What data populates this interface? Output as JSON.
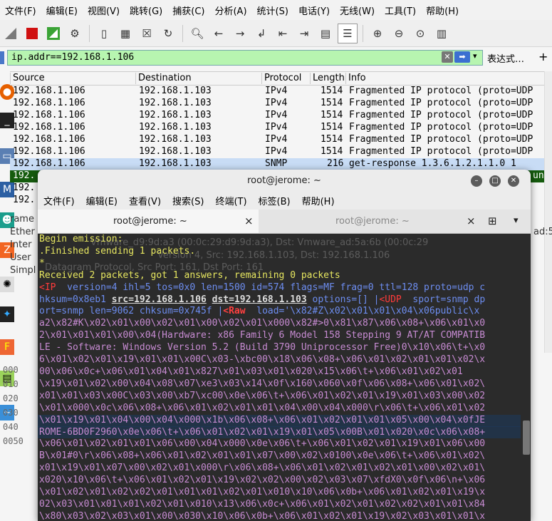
{
  "menu": [
    "文件(F)",
    "编辑(E)",
    "视图(V)",
    "跳转(G)",
    "捕获(C)",
    "分析(A)",
    "统计(S)",
    "电话(Y)",
    "无线(W)",
    "工具(T)",
    "帮助(H)"
  ],
  "filter": {
    "value": "ip.addr==192.168.1.106",
    "expression_label": "表达式…",
    "plus": "+"
  },
  "columns": {
    "source": "Source",
    "destination": "Destination",
    "protocol": "Protocol",
    "length": "Length",
    "info": "Info"
  },
  "packets": [
    {
      "src": "192.168.1.106",
      "dst": "192.168.1.103",
      "proto": "IPv4",
      "len": "1514",
      "info": "Fragmented IP protocol (proto=UDP"
    },
    {
      "src": "192.168.1.106",
      "dst": "192.168.1.103",
      "proto": "IPv4",
      "len": "1514",
      "info": "Fragmented IP protocol (proto=UDP"
    },
    {
      "src": "192.168.1.106",
      "dst": "192.168.1.103",
      "proto": "IPv4",
      "len": "1514",
      "info": "Fragmented IP protocol (proto=UDP"
    },
    {
      "src": "192.168.1.106",
      "dst": "192.168.1.103",
      "proto": "IPv4",
      "len": "1514",
      "info": "Fragmented IP protocol (proto=UDP"
    },
    {
      "src": "192.168.1.106",
      "dst": "192.168.1.103",
      "proto": "IPv4",
      "len": "1514",
      "info": "Fragmented IP protocol (proto=UDP"
    },
    {
      "src": "192.168.1.106",
      "dst": "192.168.1.103",
      "proto": "IPv4",
      "len": "1514",
      "info": "Fragmented IP protocol (proto=UDP"
    },
    {
      "src": "192.168.1.106",
      "dst": "192.168.1.103",
      "proto": "SNMP",
      "len": "216",
      "info": "get-response 1.3.6.1.2.1.1.0 1"
    }
  ],
  "partial_rows": [
    "192.",
    "192.",
    "192."
  ],
  "green_row_tail": "un",
  "detail_lines": [
    {
      "visible": "rame",
      "tail": ""
    },
    {
      "visible": "Ether",
      "tail": "ad:5a"
    },
    {
      "visible": "Inter",
      "tail": ""
    },
    {
      "visible": "User",
      "tail": ""
    },
    {
      "visible": "Simpl",
      "tail": ""
    }
  ],
  "detail_bg": [
    "Vmware_d9:9d:a3 (00:0c:29:d9:9d:a3), Dst: Vmware_ad:5a:6b (00:0c:29",
    "Version 4, Src: 192.168.1.103, Dst: 192.168.1.106",
    "Datagram Protocol, Src Port: 161, Dst Port: 161",
    "Network Management Protocol"
  ],
  "hex_offsets": [
    "000",
    "010",
    "020",
    "030",
    "040",
    "0050"
  ],
  "terminal": {
    "title": "root@jerome: ~",
    "menu": [
      "文件(F)",
      "编辑(E)",
      "查看(V)",
      "搜索(S)",
      "终端(T)",
      "标签(B)",
      "帮助(H)"
    ],
    "tab1": "root@jerome: ~",
    "tab2": "root@jerome: ~",
    "close": "×",
    "newtab": "⊞",
    "dropdown": "▾",
    "lines": {
      "l1": "Begin emission:",
      "l2": ".Finished sending 1 packets.",
      "l3": "*",
      "l4": "Received 2 packets, got 1 answers, remaining 0 packets",
      "ip_tag": "<IP",
      "ip_fields": "  version=4 ihl=5 tos=0x0 len=1500 id=574 flags=MF frag=0 ttl=128 proto=udp c",
      "chk": "hksum=0x8eb1 ",
      "src_k": "src",
      "eq": "=",
      "src_v": "192.168.1.106",
      "sp": " ",
      "dst_k": "dst",
      "dst_v": "192.168.1.103",
      "opts": " options=[] |",
      "udp_tag": "<UDP",
      "udp_fields": "  sport=snmp dp",
      "l7a": "ort=snmp len=9062 chksum=0x745f |",
      "raw_tag": "<Raw",
      "raw_fields": "  load='\\x82#Z\\x02\\x01\\x01\\x04\\x06public\\x",
      "d1": "a2\\x82#K\\x02\\x01\\x00\\x02\\x01\\x00\\x02\\x01\\x000\\x82#>0\\x81\\x87\\x06\\x08+\\x06\\x01\\x0",
      "d2": "2\\x01\\x01\\x01\\x00\\x04(Hardware: x86 Family 6 Model 158 Stepping 9 AT/AT COMPATIB",
      "d3": "LE - Software: Windows Version 5.2 (Build 3790 Uniprocessor Free)0\\x10\\x06\\t+\\x0",
      "d4": "6\\x01\\x02\\x01\\x19\\x01\\x01\\x00C\\x03-\\xbc00\\x18\\x06\\x08+\\x06\\x01\\x02\\x01\\x01\\x02\\x",
      "d5": "00\\x06\\x0c+\\x06\\x01\\x04\\x01\\x827\\x01\\x03\\x01\\x020\\x15\\x06\\t+\\x06\\x01\\x02\\x01",
      "d6": "\\x19\\x01\\x02\\x00\\x04\\x08\\x07\\xe3\\x03\\x14\\x0f\\x160\\x060\\x0f\\x06\\x08+\\x06\\x01\\x02\\",
      "d7": "x01\\x01\\x03\\x00C\\x03\\x00\\xb7\\xc00\\x0e\\x06\\t+\\x06\\x01\\x02\\x01\\x19\\x01\\x03\\x00\\x02",
      "d8": "\\x01\\x000\\x0c\\x06\\x08+\\x06\\x01\\x02\\x01\\x01\\x04\\x00\\x04\\x000\\r\\x06\\t+\\x06\\x01\\x02",
      "d9": "\\x01\\x19\\x01\\x04\\x00\\x04\\x000\\x1b\\x06\\x08+\\x06\\x01\\x02\\x01\\x01\\x05\\x00\\x04\\x0fJE",
      "d10": "ROME-6BD0F2960\\x0e\\x06\\t+\\x06\\x01\\x02\\x01\\x19\\x01\\x05\\x00B\\x01\\x020\\x0c\\x06\\x08+",
      "d11": "\\x06\\x01\\x02\\x01\\x01\\x06\\x00\\x04\\x000\\x0e\\x06\\t+\\x06\\x01\\x02\\x01\\x19\\x01\\x06\\x00",
      "d12": "B\\x01#0\\r\\x06\\x08+\\x06\\x01\\x02\\x01\\x01\\x07\\x00\\x02\\x0100\\x0e\\x06\\t+\\x06\\x01\\x02\\",
      "d13": "x01\\x19\\x01\\x07\\x00\\x02\\x01\\x000\\r\\x06\\x08+\\x06\\x01\\x02\\x01\\x02\\x01\\x00\\x02\\x01\\",
      "d14": "x020\\x10\\x06\\t+\\x06\\x01\\x02\\x01\\x19\\x02\\x02\\x00\\x02\\x03\\x07\\xfdX0\\x0f\\x06\\n+\\x06",
      "d15": "\\x01\\x02\\x01\\x02\\x02\\x01\\x01\\x01\\x02\\x01\\x010\\x10\\x06\\x0b+\\x06\\x01\\x02\\x01\\x19\\x",
      "d16": "02\\x03\\x01\\x01\\x01\\x02\\x01\\x010\\x13\\x06\\x0c+\\x06\\x01\\x02\\x01\\x02\\x02\\x01\\x01\\x84",
      "d17": "\\x80\\x03\\x02\\x03\\x01\\x00\\x030\\x10\\x06\\x0b+\\x06\\x01\\x02\\x01\\x19\\x02\\x03\\x01\\x01\\x"
    }
  },
  "colors": {
    "filter_bg": "#b7f5b0",
    "selected_row": "#c8dcf5",
    "green_row": "#155b0d",
    "terminal_bg": "#2b2b2b",
    "prompt_yellow": "#e7e760",
    "tag_red": "#ff3b3b",
    "field_blue": "#6d8df0"
  }
}
